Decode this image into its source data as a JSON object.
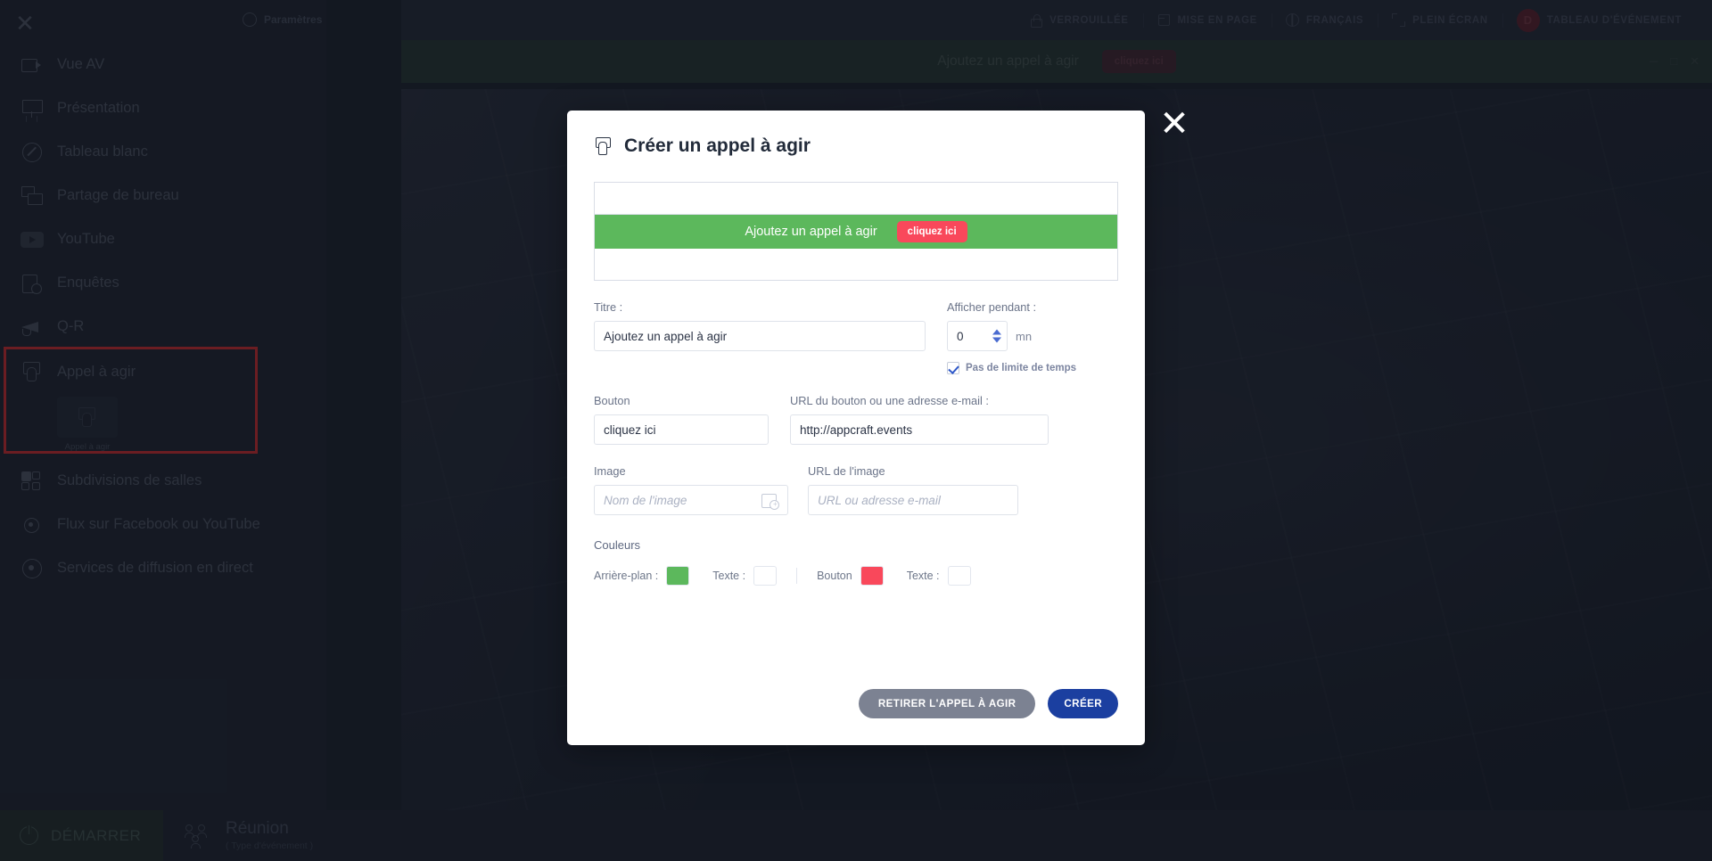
{
  "top_bar": {
    "items": [
      {
        "label": "VERROUILLÉE",
        "icon": "lock-icon"
      },
      {
        "label": "MISE EN PAGE",
        "icon": "layout-icon"
      },
      {
        "label": "FRANÇAIS",
        "icon": "globe-icon"
      },
      {
        "label": "PLEIN ÉCRAN",
        "icon": "fullscreen-icon"
      },
      {
        "label": "TABLEAU D'ÉVÉNEMENT",
        "icon": "avatar-icon",
        "avatar_letter": "D"
      }
    ]
  },
  "cta_strip": {
    "text": "Ajoutez un appel à agir",
    "button": "cliquez ici"
  },
  "sidebar": {
    "close_icon": "close-icon",
    "settings_label": "Paramètres",
    "items": [
      {
        "label": "Vue AV",
        "icon": "camera-icon"
      },
      {
        "label": "Présentation",
        "icon": "presentation-icon"
      },
      {
        "label": "Tableau blanc",
        "icon": "whiteboard-pencil-icon"
      },
      {
        "label": "Partage de bureau",
        "icon": "desktop-share-icon"
      },
      {
        "label": "YouTube",
        "icon": "youtube-icon"
      },
      {
        "label": "Enquêtes",
        "icon": "survey-clipboard-icon"
      },
      {
        "label": "Q-R",
        "icon": "megaphone-icon"
      },
      {
        "label": "Appel à agir",
        "icon": "call-to-action-icon",
        "sub_caption": "Appel à agir"
      },
      {
        "label": "Subdivisions de salles",
        "icon": "grid-rooms-icon"
      },
      {
        "label": "Flux sur Facebook ou YouTube",
        "icon": "broadcast-icon"
      },
      {
        "label": "Services de diffusion en direct",
        "icon": "live-stream-icon"
      }
    ]
  },
  "bottom_bar": {
    "start_label": "DÉMARRER",
    "start_icon": "power-icon",
    "meeting_icon": "people-icon",
    "meeting_title": "Réunion",
    "meeting_subtitle": "( Type d'événement )"
  },
  "modal": {
    "title": "Créer un appel à agir",
    "title_icon": "call-to-action-icon",
    "close_icon": "close-icon",
    "preview": {
      "band_text": "Ajoutez un appel à agir",
      "band_button": "cliquez ici"
    },
    "fields": {
      "title_label": "Titre :",
      "title_value": "Ajoutez un appel à agir",
      "duration_label": "Afficher pendant :",
      "duration_value": "0",
      "duration_unit": "mn",
      "no_time_limit_label": "Pas de limite de temps",
      "no_time_limit_checked": true,
      "button_label": "Bouton",
      "button_value": "cliquez ici",
      "url_label": "URL du bouton ou une adresse e-mail :",
      "url_value": "http://appcraft.events",
      "image_label": "Image",
      "image_placeholder": "Nom de l'image",
      "image_icon": "add-image-icon",
      "image_url_label": "URL de l'image",
      "image_url_placeholder": "URL ou adresse e-mail"
    },
    "colors": {
      "section_label": "Couleurs",
      "background_label": "Arrière-plan :",
      "background_color": "#5cb85c",
      "background_text_label": "Texte :",
      "background_text_color": "#ffffff",
      "button_label": "Bouton",
      "button_color": "#f9485b",
      "button_text_label": "Texte :",
      "button_text_color": "#ffffff"
    },
    "footer": {
      "remove_label": "RETIRER L'APPEL À AGIR",
      "create_label": "CRÉER"
    }
  }
}
